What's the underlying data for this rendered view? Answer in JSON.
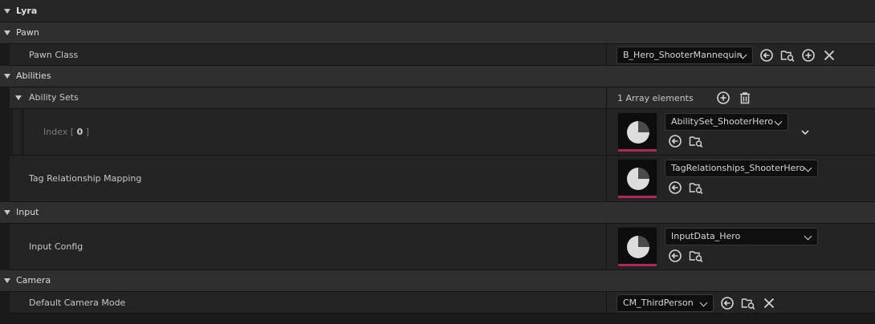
{
  "categories": {
    "lyra": "Lyra",
    "pawn": "Pawn",
    "abilities": "Abilities",
    "input": "Input",
    "camera": "Camera"
  },
  "pawn_class": {
    "label": "Pawn Class",
    "value": "B_Hero_ShooterMannequin"
  },
  "ability_sets": {
    "label": "Ability Sets",
    "count": "1 Array elements",
    "index_prefix": "Index [",
    "index_value": "0",
    "index_suffix": "]",
    "element_value": "AbilitySet_ShooterHero"
  },
  "tag_relationship": {
    "label": "Tag Relationship Mapping",
    "value": "TagRelationships_ShooterHero"
  },
  "input_config": {
    "label": "Input Config",
    "value": "InputData_Hero"
  },
  "camera_mode": {
    "label": "Default Camera Mode",
    "value": "CM_ThirdPerson"
  },
  "icons": {
    "use": "use-selected-icon",
    "browse": "browse-folder-icon",
    "add": "add-icon",
    "clear": "clear-x-icon",
    "delete": "trash-icon",
    "expand": "chevron-down-icon",
    "thumbnail": "data-asset-thumbnail-icon"
  },
  "colors": {
    "asset_accent": "#b0275b",
    "panel": "#242424",
    "category": "#2f2f2f"
  }
}
